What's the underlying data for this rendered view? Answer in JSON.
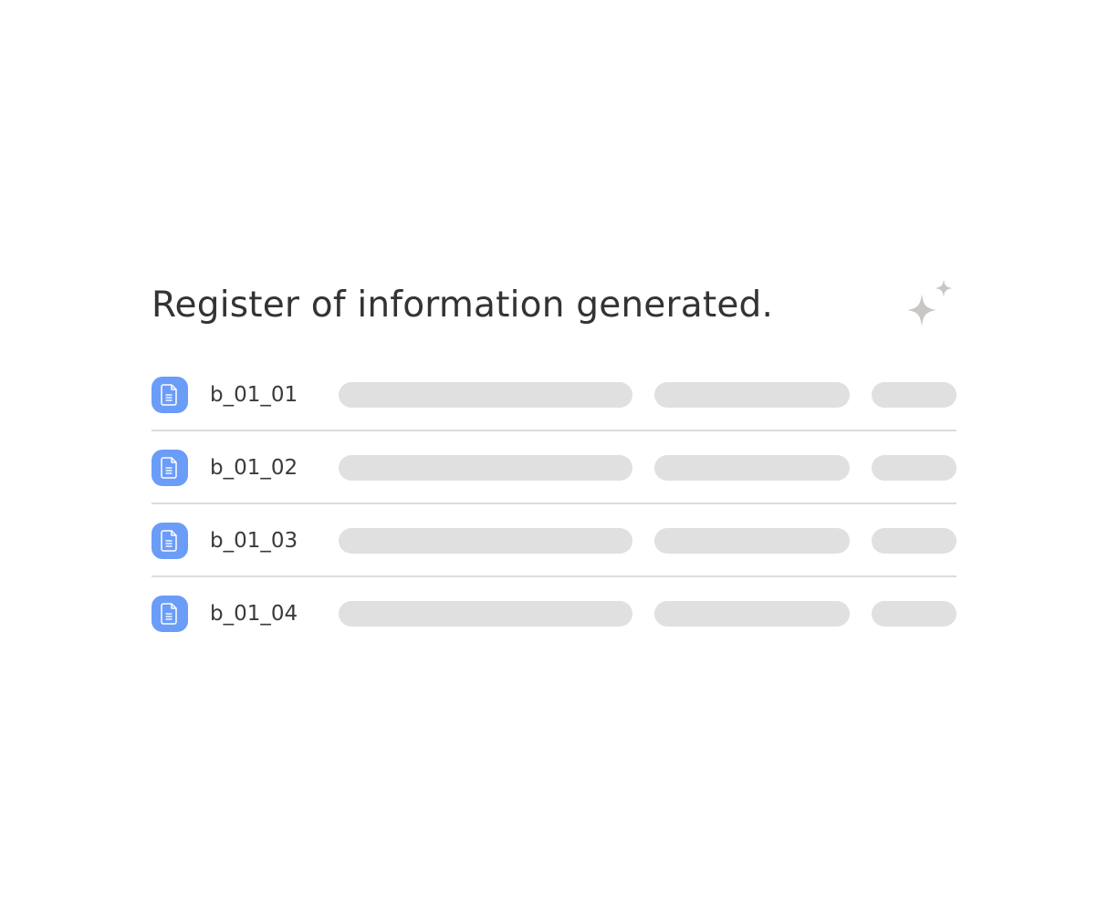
{
  "title": "Register of information generated.",
  "icons": {
    "sparkle": "sparkle-icon",
    "document": "document-icon"
  },
  "colors": {
    "accent": "#6b9cf7",
    "skeleton": "#e0e0e0",
    "sparkle": "#c9c7c2",
    "text": "#333333"
  },
  "rows": [
    {
      "name": "b_01_01"
    },
    {
      "name": "b_01_02"
    },
    {
      "name": "b_01_03"
    },
    {
      "name": "b_01_04"
    }
  ]
}
